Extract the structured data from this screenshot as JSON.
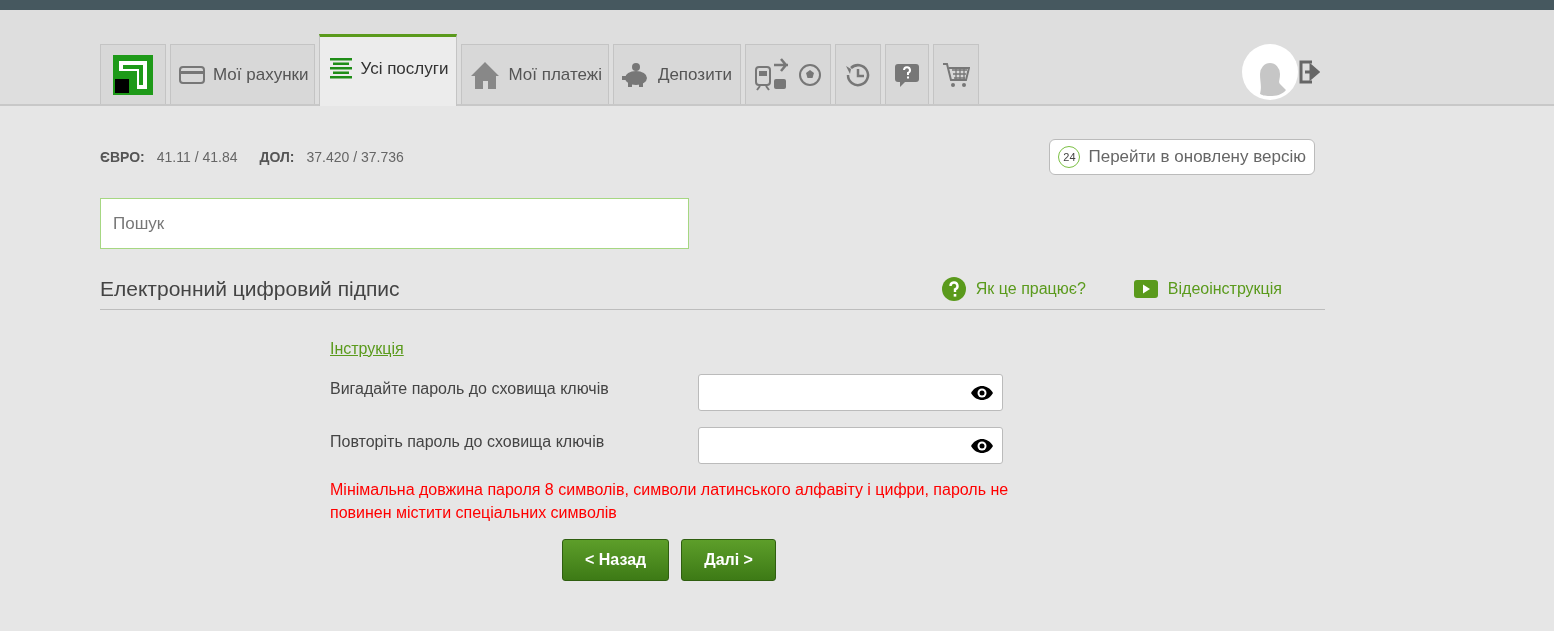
{
  "tabs": [
    {
      "kind": "logo",
      "selected": false
    },
    {
      "kind": "accounts",
      "label": "Мої рахунки",
      "selected": false
    },
    {
      "kind": "services",
      "label": "Усі послуги",
      "selected": true
    },
    {
      "kind": "payments",
      "label": "Мої платежі",
      "selected": false
    },
    {
      "kind": "deposits",
      "label": "Депозити",
      "selected": false
    },
    {
      "kind": "travel",
      "selected": false
    },
    {
      "kind": "history",
      "selected": false
    },
    {
      "kind": "help",
      "selected": false
    },
    {
      "kind": "cart",
      "selected": false
    }
  ],
  "rates": [
    {
      "currency": "ЄВРО:",
      "value": "41.11 / 41.84"
    },
    {
      "currency": "ДОЛ:",
      "value": "37.420 / 37.736"
    }
  ],
  "update_button": {
    "badge": "24",
    "label": "Перейти в оновлену версію"
  },
  "search": {
    "placeholder": "Пошук"
  },
  "section": {
    "title": "Електронний цифровий підпис",
    "help_link": "Як це працює?",
    "video_link": "Відеоінструкція"
  },
  "form": {
    "instruction_link": "Інструкція",
    "fields": [
      {
        "label": "Вигадайте пароль до сховища ключів"
      },
      {
        "label": "Повторіть пароль до сховища ключів"
      }
    ],
    "error": "Мінімальна довжина пароля 8 символів, символи латинського алфавіту і цифри, пароль не повинен містити спеціальних символів",
    "buttons": [
      "< Назад",
      "Далі >"
    ]
  }
}
